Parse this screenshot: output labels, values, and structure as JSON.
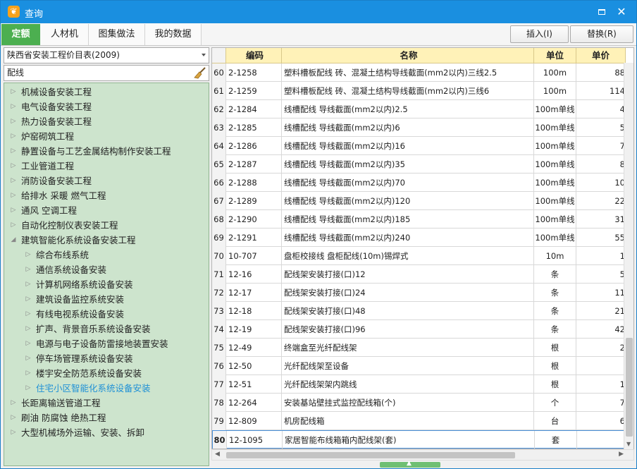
{
  "window": {
    "title": "查询"
  },
  "tabs": [
    {
      "label": "定额",
      "active": true
    },
    {
      "label": "人材机"
    },
    {
      "label": "图集做法"
    },
    {
      "label": "我的数据"
    }
  ],
  "toolbar": {
    "insert_label": "插入(I)",
    "replace_label": "替换(R)"
  },
  "library": {
    "selected": "陕西省安装工程价目表(2009)"
  },
  "search": {
    "value": "配线"
  },
  "tree": [
    {
      "label": "机械设备安装工程",
      "level": 0,
      "expanded": false
    },
    {
      "label": "电气设备安装工程",
      "level": 0,
      "expanded": false
    },
    {
      "label": "热力设备安装工程",
      "level": 0,
      "expanded": false
    },
    {
      "label": "炉窑砌筑工程",
      "level": 0,
      "expanded": false
    },
    {
      "label": "静置设备与工艺金属结构制作安装工程",
      "level": 0,
      "expanded": false
    },
    {
      "label": "工业管道工程",
      "level": 0,
      "expanded": false
    },
    {
      "label": "消防设备安装工程",
      "level": 0,
      "expanded": false
    },
    {
      "label": "给排水 采暖 燃气工程",
      "level": 0,
      "expanded": false
    },
    {
      "label": "通风 空调工程",
      "level": 0,
      "expanded": false
    },
    {
      "label": "自动化控制仪表安装工程",
      "level": 0,
      "expanded": false
    },
    {
      "label": "建筑智能化系统设备安装工程",
      "level": 0,
      "expanded": true
    },
    {
      "label": "综合布线系统",
      "level": 1,
      "expanded": false
    },
    {
      "label": "通信系统设备安装",
      "level": 1,
      "expanded": false
    },
    {
      "label": "计算机网络系统设备安装",
      "level": 1,
      "expanded": false
    },
    {
      "label": "建筑设备监控系统安装",
      "level": 1,
      "expanded": false
    },
    {
      "label": "有线电视系统设备安装",
      "level": 1,
      "expanded": false
    },
    {
      "label": "扩声、背景音乐系统设备安装",
      "level": 1,
      "expanded": false
    },
    {
      "label": "电源与电子设备防雷接地装置安装",
      "level": 1,
      "expanded": false
    },
    {
      "label": "停车场管理系统设备安装",
      "level": 1,
      "expanded": false
    },
    {
      "label": "楼宇安全防范系统设备安装",
      "level": 1,
      "expanded": false
    },
    {
      "label": "住宅小区智能化系统设备安装",
      "level": 1,
      "expanded": false,
      "selected": true
    },
    {
      "label": "长距离输送管道工程",
      "level": 0,
      "expanded": false
    },
    {
      "label": "刷油 防腐蚀 绝热工程",
      "level": 0,
      "expanded": false
    },
    {
      "label": "大型机械场外运输、安装、拆卸",
      "level": 0,
      "expanded": false
    }
  ],
  "grid": {
    "columns": [
      "",
      "编码",
      "名称",
      "单位",
      "单价"
    ],
    "current_row": "80",
    "rows": [
      {
        "no": "60",
        "code": "2-1258",
        "name": "塑料槽板配线 砖、混凝土结构导线截面(mm2以内)三线2.5",
        "unit": "100m",
        "price": "88"
      },
      {
        "no": "61",
        "code": "2-1259",
        "name": "塑料槽板配线 砖、混凝土结构导线截面(mm2以内)三线6",
        "unit": "100m",
        "price": "114"
      },
      {
        "no": "62",
        "code": "2-1284",
        "name": "线槽配线 导线截面(mm2以内)2.5",
        "unit": "100m单线",
        "price": "4"
      },
      {
        "no": "63",
        "code": "2-1285",
        "name": "线槽配线 导线截面(mm2以内)6",
        "unit": "100m单线",
        "price": "5"
      },
      {
        "no": "64",
        "code": "2-1286",
        "name": "线槽配线 导线截面(mm2以内)16",
        "unit": "100m单线",
        "price": "7"
      },
      {
        "no": "65",
        "code": "2-1287",
        "name": "线槽配线 导线截面(mm2以内)35",
        "unit": "100m单线",
        "price": "8"
      },
      {
        "no": "66",
        "code": "2-1288",
        "name": "线槽配线 导线截面(mm2以内)70",
        "unit": "100m单线",
        "price": "10"
      },
      {
        "no": "67",
        "code": "2-1289",
        "name": "线槽配线 导线截面(mm2以内)120",
        "unit": "100m单线",
        "price": "22"
      },
      {
        "no": "68",
        "code": "2-1290",
        "name": "线槽配线 导线截面(mm2以内)185",
        "unit": "100m单线",
        "price": "31"
      },
      {
        "no": "69",
        "code": "2-1291",
        "name": "线槽配线 导线截面(mm2以内)240",
        "unit": "100m单线",
        "price": "55"
      },
      {
        "no": "70",
        "code": "10-707",
        "name": "盘柜校接线 盘柜配线(10m)锡焊式",
        "unit": "10m",
        "price": "1"
      },
      {
        "no": "71",
        "code": "12-16",
        "name": "配线架安装打接(口)12",
        "unit": "条",
        "price": "5"
      },
      {
        "no": "72",
        "code": "12-17",
        "name": "配线架安装打接(口)24",
        "unit": "条",
        "price": "11"
      },
      {
        "no": "73",
        "code": "12-18",
        "name": "配线架安装打接(口)48",
        "unit": "条",
        "price": "21"
      },
      {
        "no": "74",
        "code": "12-19",
        "name": "配线架安装打接(口)96",
        "unit": "条",
        "price": "42"
      },
      {
        "no": "75",
        "code": "12-49",
        "name": "终端盒至光纤配线架",
        "unit": "根",
        "price": "2"
      },
      {
        "no": "76",
        "code": "12-50",
        "name": "光纤配线架至设备",
        "unit": "根",
        "price": ""
      },
      {
        "no": "77",
        "code": "12-51",
        "name": "光纤配线架架内跳线",
        "unit": "根",
        "price": "1"
      },
      {
        "no": "78",
        "code": "12-264",
        "name": "安装基站壁挂式监控配线箱(个)",
        "unit": "个",
        "price": "7"
      },
      {
        "no": "79",
        "code": "12-809",
        "name": "机房配线箱",
        "unit": "台",
        "price": "6"
      },
      {
        "no": "80",
        "code": "12-1095",
        "name": "家居智能布线箱箱内配线架(套)",
        "unit": "套",
        "price": ""
      }
    ]
  }
}
